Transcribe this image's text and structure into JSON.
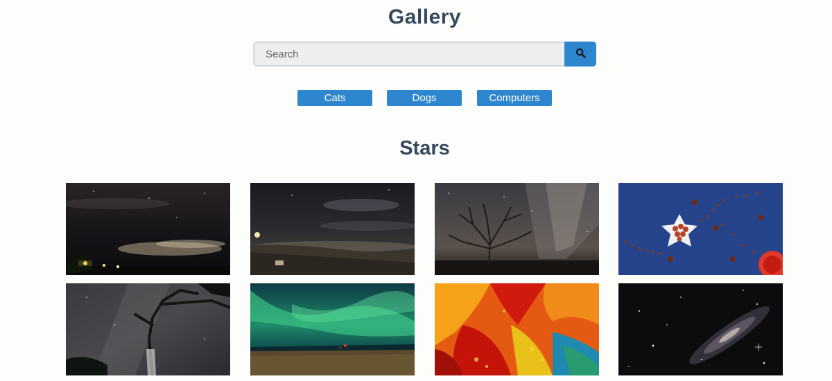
{
  "header": {
    "title": "Gallery"
  },
  "search": {
    "placeholder": "Search",
    "value": "",
    "button_icon": "search-icon"
  },
  "tags": [
    {
      "label": "Cats"
    },
    {
      "label": "Dogs"
    },
    {
      "label": "Computers"
    }
  ],
  "section": {
    "title": "Stars"
  },
  "colors": {
    "accent": "#2e86cf",
    "heading": "#34495e"
  },
  "images": [
    {
      "subject": "night-sky-coast-clouds"
    },
    {
      "subject": "night-beach-lighthouse"
    },
    {
      "subject": "milky-way-bare-tree"
    },
    {
      "subject": "star-dish-with-nuts-on-blue"
    },
    {
      "subject": "milky-way-dead-tree"
    },
    {
      "subject": "green-aurora-over-sea"
    },
    {
      "subject": "red-orange-fluid-art"
    },
    {
      "subject": "galaxy-starfield"
    }
  ]
}
